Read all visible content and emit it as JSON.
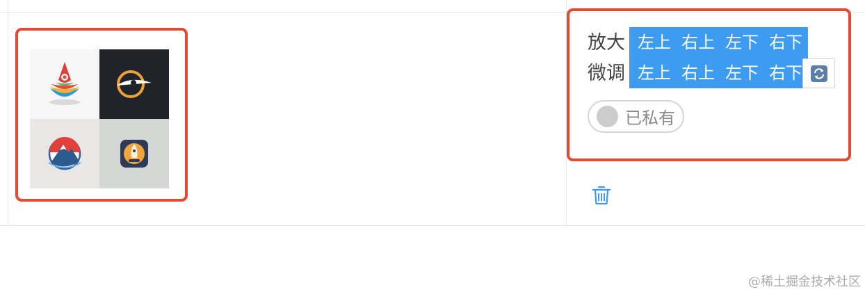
{
  "zoom_row": {
    "label": "放大",
    "buttons": [
      "左上",
      "右上",
      "左下",
      "右下"
    ]
  },
  "adjust_row": {
    "label": "微调",
    "buttons": [
      "左上",
      "右上",
      "左下",
      "右下"
    ]
  },
  "private_toggle": {
    "label": "已私有",
    "state": "off"
  },
  "image_grid": {
    "tiles": [
      "compass-logo",
      "orbit-eye-logo",
      "mountain-circle-logo",
      "rocket-app-icon"
    ]
  },
  "icons": {
    "refresh": "refresh-icon",
    "delete": "trash-icon"
  },
  "colors": {
    "accent": "#3d9bf0",
    "highlight": "#e24a33"
  },
  "watermark": "@稀土掘金技术社区"
}
